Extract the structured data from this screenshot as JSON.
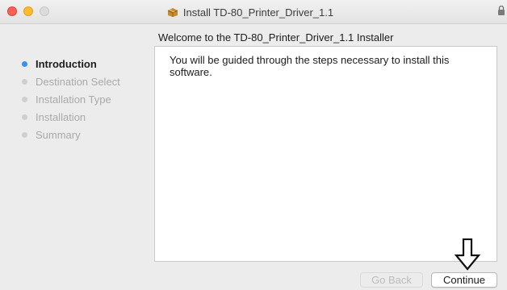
{
  "window": {
    "title": "Install TD-80_Printer_Driver_1.1",
    "title_icon": "package-icon"
  },
  "installer": {
    "heading": "Welcome to the TD-80_Printer_Driver_1.1 Installer",
    "body": "You will be guided through the steps necessary to install this software."
  },
  "sidebar": {
    "steps": [
      {
        "label": "Introduction",
        "active": true
      },
      {
        "label": "Destination Select",
        "active": false
      },
      {
        "label": "Installation Type",
        "active": false
      },
      {
        "label": "Installation",
        "active": false
      },
      {
        "label": "Summary",
        "active": false
      }
    ]
  },
  "buttons": {
    "back_label": "Go Back",
    "continue_label": "Continue"
  },
  "colors": {
    "active_step_dot": "#3b8ff4",
    "inactive_step_text": "#a9a9a9",
    "close_button": "#fd5f57",
    "minimize_button": "#fdbc2e"
  }
}
